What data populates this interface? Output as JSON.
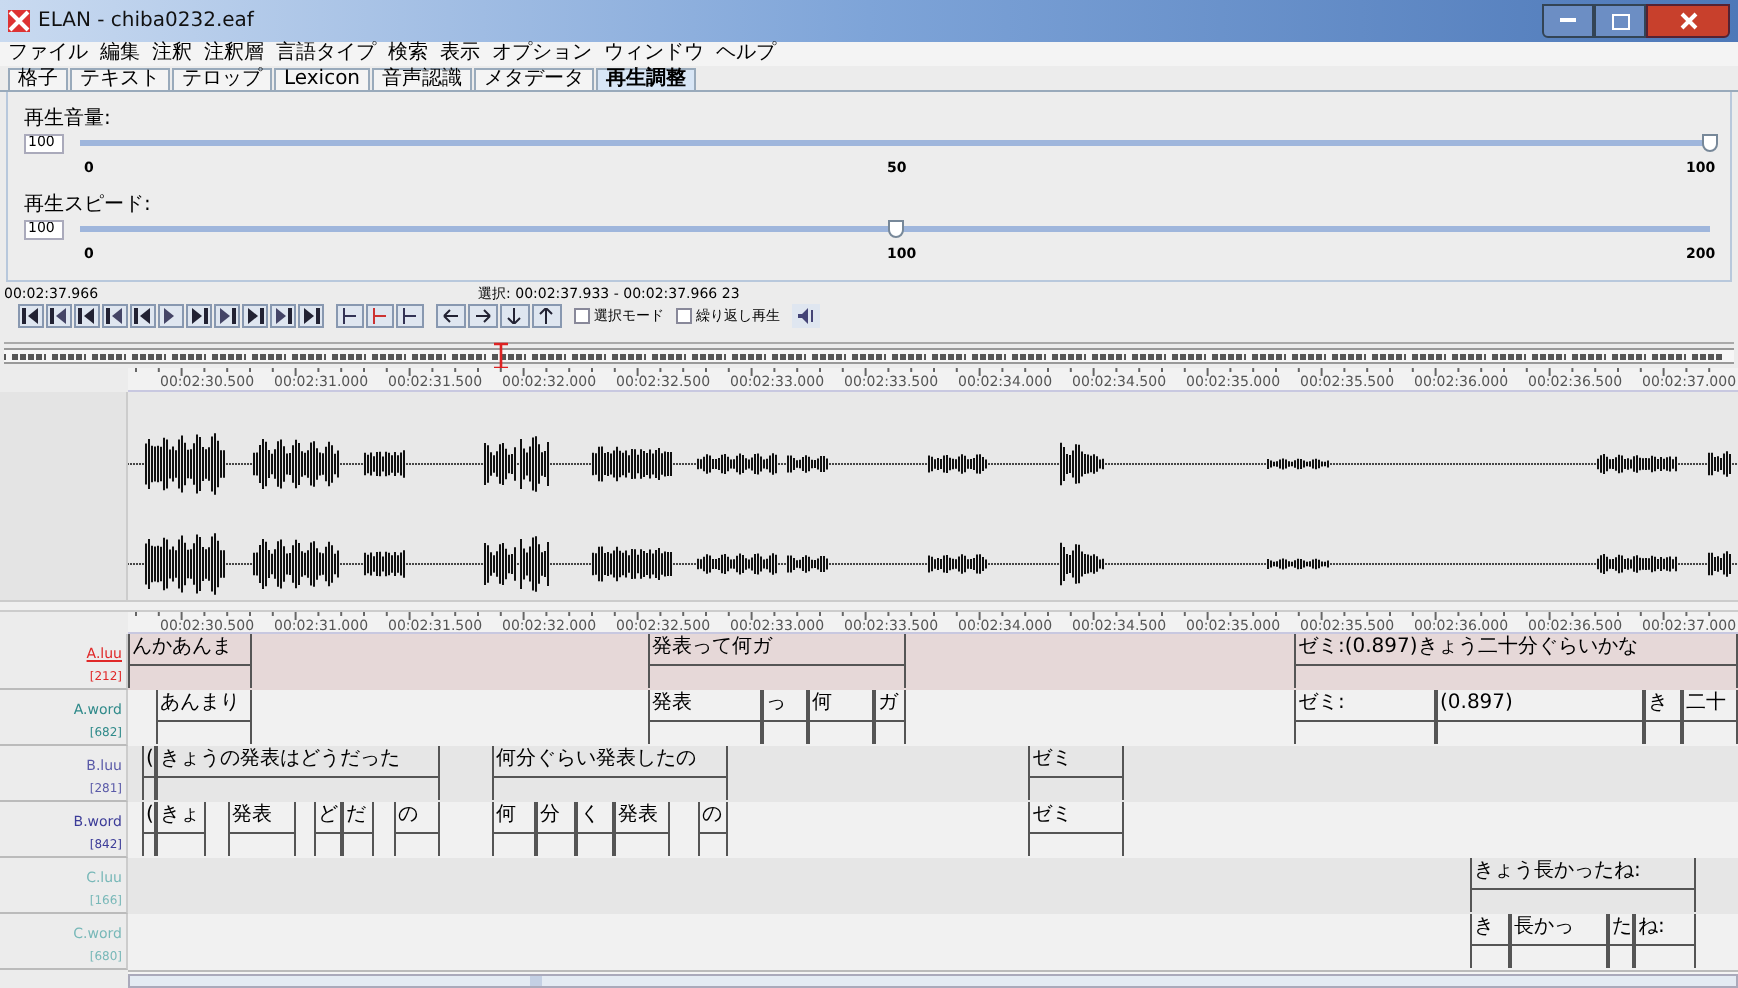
{
  "window": {
    "title": "ELAN - chiba0232.eaf"
  },
  "menu": [
    "ファイル",
    "編集",
    "注釈",
    "注釈層",
    "言語タイプ",
    "検索",
    "表示",
    "オプション",
    "ウィンドウ",
    "ヘルプ"
  ],
  "tabs": [
    {
      "label": "格子",
      "selected": false
    },
    {
      "label": "テキスト",
      "selected": false
    },
    {
      "label": "テロップ",
      "selected": false
    },
    {
      "label": "Lexicon",
      "selected": false
    },
    {
      "label": "音声認識",
      "selected": false
    },
    {
      "label": "メタデータ",
      "selected": false
    },
    {
      "label": "再生調整",
      "selected": true
    }
  ],
  "controls": [
    {
      "label": "再生音量:",
      "value": "100",
      "level": 1,
      "ticks": [
        "0",
        "50",
        "100"
      ]
    },
    {
      "label": "再生スピード:",
      "value": "100",
      "level": 0.5,
      "ticks": [
        "0",
        "100",
        "200"
      ]
    }
  ],
  "media_time": "00:02:37.966",
  "selection": "選択: 00:02:37.933 - 00:02:37.966  23",
  "checkboxes": [
    {
      "label": "選択モード",
      "checked": false
    },
    {
      "label": "繰り返し再生",
      "checked": false
    }
  ],
  "ruler_top": [
    "00:02:30.500",
    "00:02:31.000",
    "00:02:31.500",
    "00:02:32.000",
    "00:02:32.500",
    "00:02:33.000",
    "00:02:33.500",
    "00:02:34.000",
    "00:02:34.500",
    "00:02:35.000",
    "00:02:35.500",
    "00:02:36.000",
    "00:02:36.500",
    "00:02:37.000"
  ],
  "ruler_bottom": [
    "00:02:30.500",
    "00:02:31.000",
    "00:02:31.500",
    "00:02:32.000",
    "00:02:32.500",
    "00:02:33.000",
    "00:02:33.500",
    "00:02:34.000",
    "00:02:34.500",
    "00:02:35.000",
    "00:02:35.500",
    "00:02:36.000",
    "00:02:36.500",
    "00:02:37.000"
  ],
  "tiers": [
    {
      "name": "A.luu",
      "count": "[212]",
      "color": "#e02828",
      "selected": true,
      "annotations": [
        "んかあんま",
        "発表って何ガ",
        "ゼミ:(0.897)きょう二十分ぐらいかな"
      ]
    },
    {
      "name": "A.word",
      "count": "[682]",
      "color": "#2f8a8a",
      "selected": false,
      "annotations": [
        "あんまり",
        "発表",
        "っ",
        "何",
        "ガ",
        "ゼミ:",
        "(0.897)",
        "き",
        "二十"
      ]
    },
    {
      "name": "B.luu",
      "count": "[281]",
      "color": "#5a5aa8",
      "selected": false,
      "annotations": [
        "(",
        "きょうの発表はどうだった",
        "何分ぐらい発表したの",
        "ゼミ"
      ]
    },
    {
      "name": "B.word",
      "count": "[842]",
      "color": "#3c3c98",
      "selected": false,
      "annotations": [
        "(",
        "きょ",
        "発表",
        "ど",
        "だ",
        "の",
        "何",
        "分",
        "く",
        "発表",
        "の",
        "ゼミ"
      ]
    },
    {
      "name": "C.luu",
      "count": "[166]",
      "color": "#78b8b8",
      "selected": false,
      "annotations": [
        "きょう長かったね:"
      ]
    },
    {
      "name": "C.word",
      "count": "[680]",
      "color": "#78b8b8",
      "selected": false,
      "annotations": [
        "き",
        "長かっ",
        "た",
        "ね:"
      ]
    }
  ]
}
